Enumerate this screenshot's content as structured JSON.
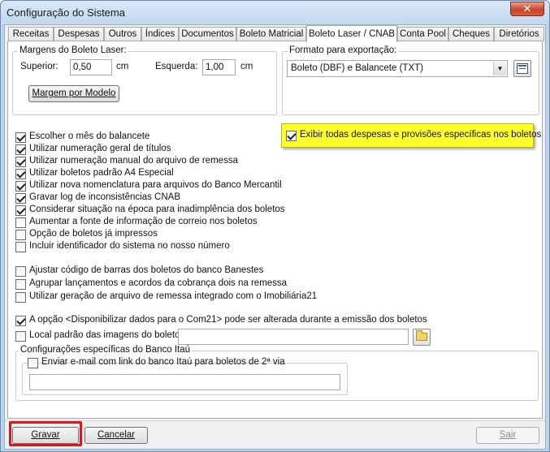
{
  "window": {
    "title": "Configuração do Sistema",
    "close_symbol": "✕"
  },
  "tabs": [
    {
      "label": "Receitas"
    },
    {
      "label": "Despesas"
    },
    {
      "label": "Outros"
    },
    {
      "label": "Índices"
    },
    {
      "label": "Documentos"
    },
    {
      "label": "Boleto Matricial"
    },
    {
      "label": "Boleto Laser / CNAB",
      "active": true
    },
    {
      "label": "Conta Pool"
    },
    {
      "label": "Cheques"
    },
    {
      "label": "Diretórios"
    }
  ],
  "margins": {
    "group_label": "Margens do Boleto Laser:",
    "top_label": "Superior:",
    "top_value": "0,50",
    "top_unit": "cm",
    "left_label": "Esquerda:",
    "left_value": "1,00",
    "left_unit": "cm",
    "model_button": "Margem por Modelo"
  },
  "export": {
    "group_label": "Formato para exportação:",
    "selected": "Boleto (DBF) e Balancete (TXT)",
    "props_icon": "properties-icon"
  },
  "highlight_option": {
    "label": "Exibir todas despesas e provisões específicas nos boletos",
    "checked": true
  },
  "options_a": [
    {
      "label": "Escolher o mês do balancete",
      "checked": true
    },
    {
      "label": "Utilizar numeração geral de títulos",
      "checked": true
    },
    {
      "label": "Utilizar numeração manual do arquivo de remessa",
      "checked": true
    },
    {
      "label": "Utilizar boletos padrão A4 Especial",
      "checked": true
    },
    {
      "label": "Utilizar nova nomenclatura para arquivos do Banco Mercantil",
      "checked": true
    },
    {
      "label": "Gravar log de inconsistências CNAB",
      "checked": true
    },
    {
      "label": "Considerar situação na época para inadimplência dos boletos",
      "checked": true
    },
    {
      "label": "Aumentar a fonte de informação de correio nos boletos",
      "checked": false
    },
    {
      "label": "Opção de boletos já impressos",
      "checked": false
    },
    {
      "label": "Incluir identificador do sistema no nosso número",
      "checked": false
    }
  ],
  "options_b": [
    {
      "label": "Ajustar código de barras dos boletos do banco Banestes",
      "checked": false
    },
    {
      "label": "Agrupar lançamentos e acordos da cobrança dois na remessa",
      "checked": false
    },
    {
      "label": "Utilizar geração de arquivo de remessa integrado com o Imobiliária21",
      "checked": false
    }
  ],
  "com21_option": {
    "label": "A opção <Disponibilizar dados para o Com21> pode ser alterada durante a emissão dos boletos",
    "checked": true
  },
  "image_path": {
    "label": "Local padrão das imagens do boleto:",
    "value": "",
    "icon": "folder-icon"
  },
  "itau": {
    "group_label": "Configurações específicas do Banco Itaú",
    "email_label": "Enviar e-mail com link do banco Itaú para boletos de 2ª via",
    "email_checked": false,
    "email_value": ""
  },
  "footer": {
    "save": "Gravar",
    "cancel": "Cancelar",
    "exit": "Sair",
    "highlight_color": "#e0141b"
  }
}
